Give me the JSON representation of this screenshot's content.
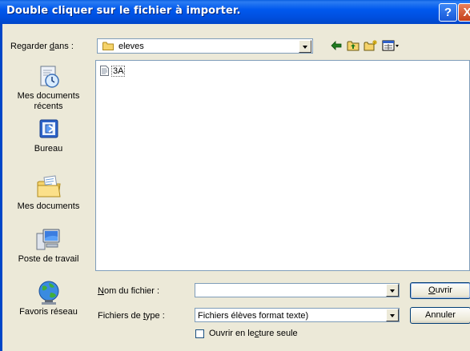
{
  "window": {
    "title": "Double cliquer sur le fichier à importer.",
    "help_button": "?",
    "close_button": "X"
  },
  "lookin": {
    "label": "Regarder dans :",
    "value": "eleves"
  },
  "toolbar": {
    "icons": [
      "back-arrow-icon",
      "up-one-level-icon",
      "new-folder-icon",
      "view-menu-icon"
    ]
  },
  "places": [
    {
      "label": "Mes documents récents",
      "icon": "recent-documents-icon"
    },
    {
      "label": "Bureau",
      "icon": "desktop-icon"
    },
    {
      "label": "Mes documents",
      "icon": "my-documents-icon"
    },
    {
      "label": "Poste de travail",
      "icon": "my-computer-icon"
    },
    {
      "label": "Favoris réseau",
      "icon": "network-places-icon"
    }
  ],
  "files": [
    {
      "name": "3A",
      "icon": "text-file-icon"
    }
  ],
  "filename": {
    "label": "Nom du fichier :",
    "value": ""
  },
  "filetype": {
    "label": "Fichiers de type :",
    "value": "Fichiers élèves format texte)"
  },
  "buttons": {
    "open": "Ouvrir",
    "cancel": "Annuler"
  },
  "readonly": {
    "label": "Ouvrir en lecture seule",
    "checked": false
  }
}
